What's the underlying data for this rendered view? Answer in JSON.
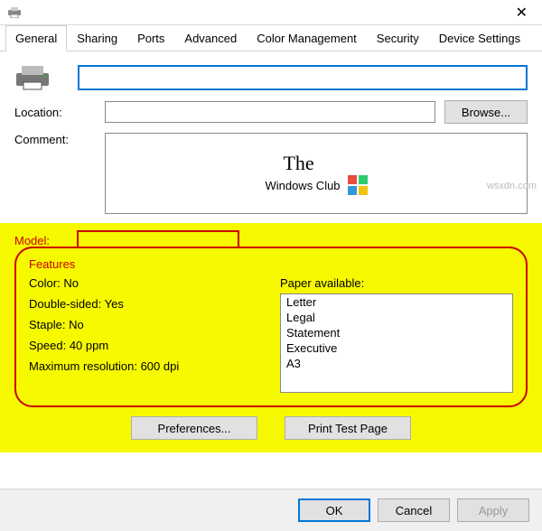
{
  "titlebar": {
    "title": ""
  },
  "tabs": [
    "General",
    "Sharing",
    "Ports",
    "Advanced",
    "Color Management",
    "Security",
    "Device Settings"
  ],
  "active_tab": 0,
  "fields": {
    "name": "",
    "location_label": "Location:",
    "location": "",
    "browse": "Browse...",
    "comment_label": "Comment:",
    "model_label": "Model:",
    "model": ""
  },
  "twc": {
    "line1": "The",
    "line2": "Windows Club"
  },
  "features": {
    "legend": "Features",
    "color_label": "Color:",
    "color_value": "No",
    "double_label": "Double-sided:",
    "double_value": "Yes",
    "staple_label": "Staple:",
    "staple_value": "No",
    "speed_label": "Speed:",
    "speed_value": "40 ppm",
    "maxres_label": "Maximum resolution:",
    "maxres_value": "600 dpi",
    "paper_label": "Paper available:",
    "paper": [
      "Letter",
      "Legal",
      "Statement",
      "Executive",
      "A3"
    ]
  },
  "buttons": {
    "preferences": "Preferences...",
    "testpage": "Print Test Page",
    "ok": "OK",
    "cancel": "Cancel",
    "apply": "Apply"
  },
  "watermark": "wsxdn.com"
}
